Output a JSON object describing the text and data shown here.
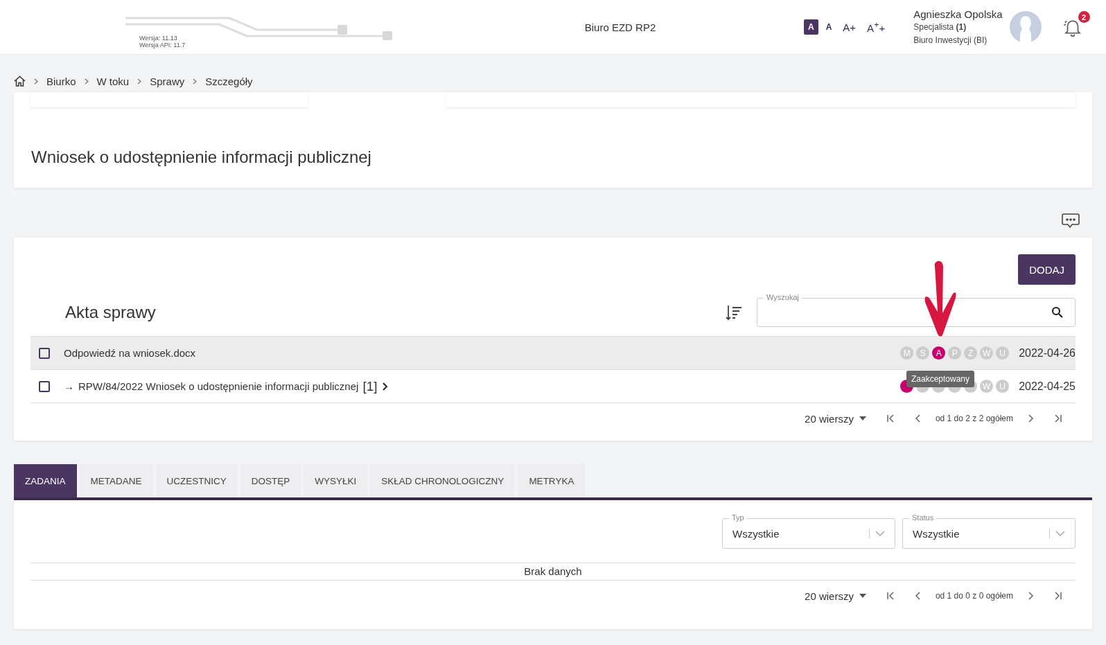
{
  "header": {
    "version": "Wersja: 11.13",
    "api_version": "Wersja API: 11.7",
    "title": "Biuro EZD RP2",
    "font_sizes": [
      {
        "label": "A",
        "selected": true
      },
      {
        "label": "A",
        "selected": false
      },
      {
        "label": "A+",
        "selected": false
      },
      {
        "label": "A$^{+}$+",
        "selected": false
      }
    ],
    "user": {
      "name": "Agnieszka Opolska",
      "role": "Specjalista **(1)**",
      "unit": "Biuro Inwestycji (BI)"
    },
    "notifications": "2"
  },
  "breadcrumb": [
    "Biurko",
    "W toku",
    "Sprawy",
    "Szczegóły"
  ],
  "case_title": "Wniosek o udostępnienie informacji publicznej",
  "files": {
    "add_button": "DODAJ",
    "title": "Akta sprawy",
    "search": {
      "label": "Wyszukaj"
    },
    "rows": [
      {
        "prefix": "",
        "name": "Odpowiedź na wniosek.docx",
        "count": "",
        "expandable": false,
        "checked": false,
        "hovered": true,
        "date": "2022-04-26",
        "statuses": [
          {
            "letter": "M",
            "active": false
          },
          {
            "letter": "S",
            "active": false
          },
          {
            "letter": "A",
            "active": true
          },
          {
            "letter": "P",
            "active": false
          },
          {
            "letter": "Z",
            "active": false
          },
          {
            "letter": "W",
            "active": false
          },
          {
            "letter": "U",
            "active": false
          }
        ]
      },
      {
        "prefix": "→",
        "name": "RPW/84/2022 Wniosek o udostępnienie informacji publicznej",
        "count": "[1]",
        "expandable": true,
        "checked": false,
        "hovered": false,
        "date": "2022-04-25",
        "statuses": [
          {
            "active": true
          },
          {
            "active": false
          },
          {
            "active": false
          },
          {
            "active": false
          },
          {
            "active": false
          },
          {
            "letter": "W",
            "active": false
          },
          {
            "letter": "U",
            "active": false
          }
        ]
      }
    ],
    "tooltip": "Zaakceptowany",
    "pager": {
      "rows": "20 wierszy",
      "range": "od 1 do 2 z 2 ogółem"
    }
  },
  "tabs": [
    {
      "label": "ZADANIA",
      "selected": true
    },
    {
      "label": "METADANE",
      "selected": false
    },
    {
      "label": "UCZESTNICY",
      "selected": false
    },
    {
      "label": "DOSTĘP",
      "selected": false
    },
    {
      "label": "WYSYŁKI",
      "selected": false
    },
    {
      "label": "SKŁAD CHRONOLOGICZNY",
      "selected": false
    },
    {
      "label": "METRYKA",
      "selected": false
    }
  ],
  "tasks": {
    "filters": [
      {
        "label": "Typ",
        "value": "Wszystkie"
      },
      {
        "label": "Status",
        "value": "Wszystkie"
      }
    ],
    "empty": "Brak danych",
    "pager": {
      "rows": "20 wierszy",
      "range": "od 1 do 0 z 0 ogółem"
    }
  }
}
